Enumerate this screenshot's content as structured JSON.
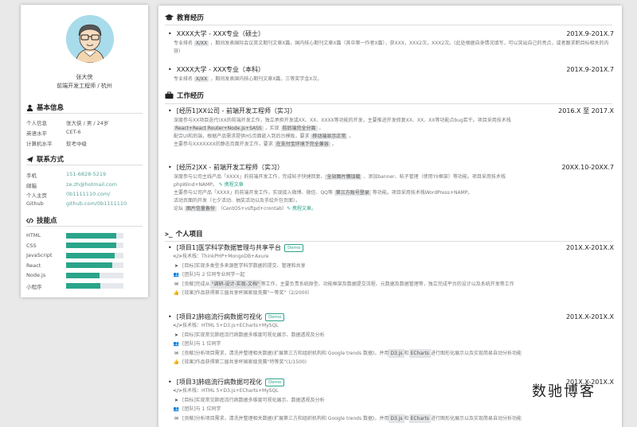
{
  "profile": {
    "name": "张大侠",
    "role": "前端开发工程师 / 杭州"
  },
  "sidebar": {
    "basic": {
      "title": "基本信息",
      "rows": [
        {
          "k": "个人信息",
          "v": "张大侠 / 男 / 24岁"
        },
        {
          "k": "英语水平",
          "v": "CET-6"
        },
        {
          "k": "计算机水平",
          "v": "软考中级"
        }
      ]
    },
    "contact": {
      "title": "联系方式",
      "rows": [
        {
          "k": "手机",
          "v": "151-6828-5219"
        },
        {
          "k": "邮箱",
          "v": "ze.zh@hotmail.com"
        },
        {
          "k": "个人主页",
          "v": "0b1111110.com/"
        },
        {
          "k": "Github",
          "v": "github.com/0b1111110"
        }
      ]
    },
    "skills": {
      "title": "技能点",
      "items": [
        {
          "name": "HTML",
          "level": 0.88
        },
        {
          "name": "CSS",
          "level": 0.88
        },
        {
          "name": "JavaScript",
          "level": 0.85
        },
        {
          "name": "React",
          "level": 0.8
        },
        {
          "name": "Node.js",
          "level": 0.58
        },
        {
          "name": "小程序",
          "level": 0.6
        }
      ]
    }
  },
  "education": {
    "title": "教育经历",
    "items": [
      {
        "title": "XXXX大学 - XXX专业（硕士）",
        "date": "201X.9-201X.7",
        "desc_a": "专业排名 ",
        "desc_hl": "X/XX",
        "desc_b": " ，期间发表国际会议英文期刊文章X篇，国内核心期刊文章X篇（其中第一作者X篇），获XXX，XXX2次，XXX2次。(此处根据自身情况填写，可以突出自己的亮点，或者跟求职目标相关的内容)"
      },
      {
        "title": "XXXX大学 - XXX专业（本科）",
        "date": "201X.9-201X.7",
        "desc_a": "专业排名 ",
        "desc_hl": "X/XX",
        "desc_b": " ，期间发表国内核心期刊文章X篇，三等奖学金X次。"
      }
    ]
  },
  "work": {
    "title": "工作经历",
    "items": [
      {
        "title": "[经历1]XX公司 - 前端开发工程师（实习）",
        "date": "2016.X 至 2017.X",
        "lines": [
          {
            "a": "深度参与XX项目迭代(XX的前端开发工作，独立承担开发或XX、XX、XXXX等功能的开发，主要推进开发修复XX、XX、XX等功能点bug若干。项目采用技术栈",
            "hl": "",
            "b": ""
          },
          {
            "a": "",
            "hl": "React+React Router+Node.js+SASS",
            "b": " ，实现 ",
            "hl2": "前后端完全分离",
            "c": " 。"
          },
          {
            "a": "配合UI和后端，根据产品需求提供H5页面嵌入到后台模板，要求 ",
            "hl": "移动端显示正常",
            "b": " 。"
          },
          {
            "a": "主要参与XXXXXXX的静态页面开发工作，要求 ",
            "hl": "在支付宝环境下完全兼容",
            "b": " 。"
          }
        ]
      },
      {
        "title": "[经历2]XX - 前端开发工程师（实习）",
        "date": "20XX.10-20XX.7",
        "lines": [
          {
            "a": "深度参与公司主线产品「XXXX」的前端开发工作，完成帖子快捷回复、",
            "hl": "全站图片懒加载",
            "b": " 、添加banner、帖子管理（使用YII框架）等功能。项目采用技术栈"
          },
          {
            "a": "phpWind+NAMP。",
            "hl": "",
            "b": "",
            "link": "✎ 携程文章"
          },
          {
            "a": "主要参与公司产品「XXXX」的前端开发工作，实现接入微博、微信、QQ等 ",
            "hl": "第三方账号登录",
            "b": " 等功能。项目采用技术栈WordPress+NAMP。"
          },
          {
            "a": "活动页面的开发（七夕活动、抽奖活动以及手绘外包页面）。",
            "hl": "",
            "b": ""
          },
          {
            "a": "论坛 ",
            "hl": "图片信量备份",
            "b": " （CentOS+vsftpd+crontab）",
            "link": "✎ 携程文章。"
          }
        ]
      }
    ]
  },
  "projects": {
    "title": "个人项目",
    "items": [
      {
        "title": "[项目1]医学科学数据管理与共享平台",
        "badge": "Demo",
        "date": "201X.X-201X.X",
        "lines": [
          {
            "icon": "code",
            "a": "技术栈：ThinkPHP+MongoDB+Axure"
          },
          {
            "icon": "send",
            "a": "[目标]实现多类型多来源医学科学数据的提交、管理和共享"
          },
          {
            "icon": "users",
            "a": "[团队]与 2 位同专业同学一起"
          },
          {
            "icon": "mail",
            "a": "[贡献]完成从 ",
            "hl": "\"调研-设计-实现-文档\"",
            "b": " 等工作，主要负责系统原型、功能框架及数据提交流程、元数据及数据管理等，独立完成平台的设计以及系统开发等工作"
          },
          {
            "icon": "thumb",
            "a": "[效果]作品获得第三届共享杯国家级竞赛\"一等奖\"（2/2000）"
          }
        ]
      },
      {
        "title": "[项目2]肺癌流行病数据可视化",
        "badge": "Demo",
        "date": "201X.X-201X.X",
        "lines": [
          {
            "icon": "code",
            "a": "技术栈：HTML 5+D3.js+ECharts+MySQL"
          },
          {
            "icon": "send",
            "a": "[目标]实现常见肺癌流行病数据多维度可视化展示、数据透视及分析"
          },
          {
            "icon": "users",
            "a": "[团队]与 1 位同学"
          },
          {
            "icon": "mail",
            "a": "[贡献]分析项目需求，清洗并整理相关数据(扩展第三方和组织机构和 Google trends 数据)，并用 ",
            "hl": "D3.js",
            "b": " 和 ",
            "hl2": "ECharts",
            "c": " 进行图形化展示以及实现简易自动分析功能"
          },
          {
            "icon": "thumb",
            "a": "[效果]作品获得第二届共享杯国家级竞赛\"特等奖\"(1/1500)"
          }
        ]
      },
      {
        "title": "[项目3]肺癌流行病数据可视化",
        "badge": "Demo",
        "date": "201X.X-201X.X",
        "lines": [
          {
            "icon": "code",
            "a": "技术栈：HTML 5+D3.js+ECharts+MySQL"
          },
          {
            "icon": "send",
            "a": "[目标]实现常见肺癌流行病数据多维度可视化展示、数据透视及分析"
          },
          {
            "icon": "users",
            "a": "[团队]与 1 位同学"
          },
          {
            "icon": "mail",
            "a": "[贡献]分析项目需求，清洗并整理相关数据(扩展第三方和组织机构和 Google trends 数据)，并用 ",
            "hl": "D3.js",
            "b": " 和 ",
            "hl2": "ECharts",
            "c": " 进行图形化展示以及实现简易自动分析功能"
          }
        ]
      }
    ]
  },
  "watermark": "数驰博客",
  "colors": {
    "accent": "#2aa58a",
    "highlight": "#e2e4e6"
  }
}
